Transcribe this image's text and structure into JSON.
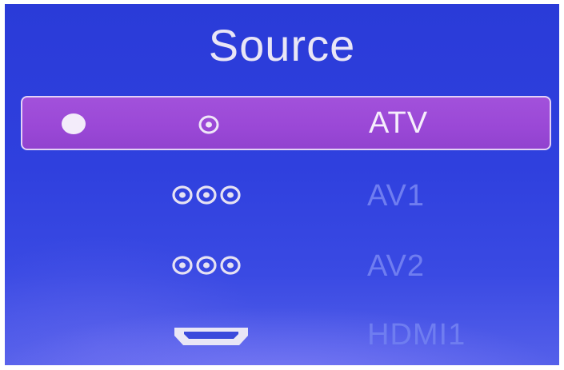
{
  "menu": {
    "title": "Source",
    "items": [
      {
        "label": "ATV",
        "icon": "antenna-icon",
        "selected": true
      },
      {
        "label": "AV1",
        "icon": "av-connector-icon",
        "selected": false
      },
      {
        "label": "AV2",
        "icon": "av-connector-icon",
        "selected": false
      },
      {
        "label": "HDMI1",
        "icon": "hdmi-port-icon",
        "selected": false
      }
    ]
  },
  "colors": {
    "background": "#2f40de",
    "selection": "#9a48d6",
    "selected_text": "#f6eefc",
    "unselected_text": "#6f7df0",
    "icon": "#e6e2f3"
  }
}
